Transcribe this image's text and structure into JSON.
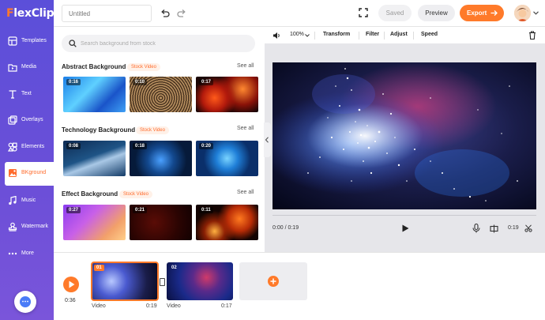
{
  "app": {
    "logo_text": "lexClip",
    "logo_letter": "F"
  },
  "sidebar": {
    "items": [
      {
        "label": "Templates",
        "icon": "templates-icon"
      },
      {
        "label": "Media",
        "icon": "media-icon"
      },
      {
        "label": "Text",
        "icon": "text-icon"
      },
      {
        "label": "Overlays",
        "icon": "overlays-icon"
      },
      {
        "label": "Elements",
        "icon": "elements-icon"
      },
      {
        "label": "BKground",
        "icon": "background-icon",
        "active": true
      },
      {
        "label": "Music",
        "icon": "music-icon"
      },
      {
        "label": "Watermark",
        "icon": "watermark-icon"
      },
      {
        "label": "More",
        "icon": "more-icon"
      }
    ]
  },
  "topbar": {
    "title_placeholder": "Untitled",
    "saved_label": "Saved",
    "preview_label": "Preview",
    "export_label": "Export"
  },
  "panel": {
    "search_placeholder": "Search background from stock",
    "sections": [
      {
        "title": "Abstract Background",
        "badge": "Stock Video",
        "see_all": "See all",
        "durations": [
          "0:16",
          "0:10",
          "0:17"
        ]
      },
      {
        "title": "Technology Background",
        "badge": "Stock Video",
        "see_all": "See all",
        "durations": [
          "0:08",
          "0:18",
          "0:20"
        ]
      },
      {
        "title": "Effect Background",
        "badge": "Stock Video",
        "see_all": "See all",
        "durations": [
          "0:27",
          "0:21",
          "0:11"
        ]
      }
    ]
  },
  "toolbar": {
    "zoom": "100%",
    "transform": "Transform",
    "filter": "Filter",
    "adjust": "Adjust",
    "speed": "Speed"
  },
  "player": {
    "time_display": "0:00 / 0:19",
    "clip_duration": "0:19"
  },
  "timeline": {
    "total_time": "0:36",
    "clips": [
      {
        "number": "01",
        "label": "Video",
        "duration": "0:19",
        "selected": true
      },
      {
        "number": "02",
        "label": "Video",
        "duration": "0:17",
        "selected": false
      }
    ]
  },
  "colors": {
    "accent": "#ff7a2a",
    "sidebar": "#5b4fd9"
  }
}
